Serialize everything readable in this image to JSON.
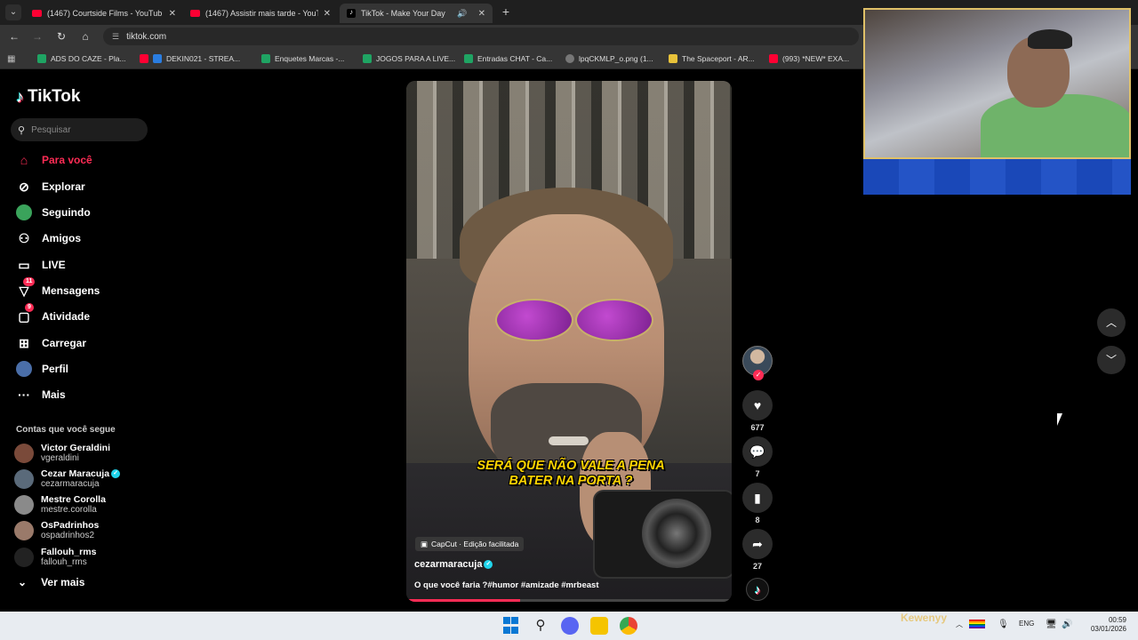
{
  "browser": {
    "tabs": [
      {
        "label": "(1467) Courtside Films - YouTub",
        "active": false
      },
      {
        "label": "(1467) Assistir mais tarde - YouT",
        "active": false
      },
      {
        "label": "TikTok - Make Your Day",
        "active": true
      }
    ],
    "url": "tiktok.com",
    "bookmarks": [
      "ADS DO CAZE - Pla...",
      "DEKIN021 - STREA...",
      "Enquetes Marcas -...",
      "JOGOS PARA A LIVE...",
      "Entradas CHAT - Ca...",
      "lpqCKMLP_o.png (1...",
      "The Spaceport - AR...",
      "(993) *NEW* EXA..."
    ]
  },
  "sidebar": {
    "logo": "TikTok",
    "search_placeholder": "Pesquisar",
    "menu": [
      {
        "label": "Para você",
        "icon": "home-icon",
        "active": true
      },
      {
        "label": "Explorar",
        "icon": "compass-icon"
      },
      {
        "label": "Seguindo",
        "icon": "following-icon"
      },
      {
        "label": "Amigos",
        "icon": "friends-icon"
      },
      {
        "label": "LIVE",
        "icon": "live-icon"
      },
      {
        "label": "Mensagens",
        "icon": "messages-icon",
        "badge": "11"
      },
      {
        "label": "Atividade",
        "icon": "activity-icon",
        "badge": "9"
      },
      {
        "label": "Carregar",
        "icon": "upload-icon"
      },
      {
        "label": "Perfil",
        "icon": "profile-icon"
      },
      {
        "label": "Mais",
        "icon": "more-icon"
      }
    ],
    "following_title": "Contas que você segue",
    "accounts": [
      {
        "name": "Victor Geraldini",
        "handle": "vgeraldini",
        "verified": false
      },
      {
        "name": "Cezar Maracuja",
        "handle": "cezarmaracuja",
        "verified": true
      },
      {
        "name": "Mestre Corolla",
        "handle": "mestre.corolla",
        "verified": false
      },
      {
        "name": "OsPadrinhos",
        "handle": "ospadrinhos2",
        "verified": false
      },
      {
        "name": "Fallouh_rms",
        "handle": "fallouh_rms",
        "verified": false
      }
    ],
    "see_more": "Ver mais"
  },
  "video": {
    "caption_line1": "SERÁ QUE NÃO VALE A PENA",
    "caption_line2": "BATER NA PORTA ?",
    "capcut_label": "CapCut · Edição facilitada",
    "author": "cezarmaracuja",
    "description": "O que você faria ?#humor #amizade #mrbeast",
    "progress": 0.35
  },
  "actions": {
    "likes": "677",
    "comments": "7",
    "saves": "8",
    "shares": "27"
  },
  "taskbar": {
    "lang": "ENG",
    "time": "00:59",
    "date": "03/01/2026",
    "watermark": "Kewenyy"
  },
  "colors": {
    "accent": "#fe2c55",
    "caption": "#ffd400"
  }
}
